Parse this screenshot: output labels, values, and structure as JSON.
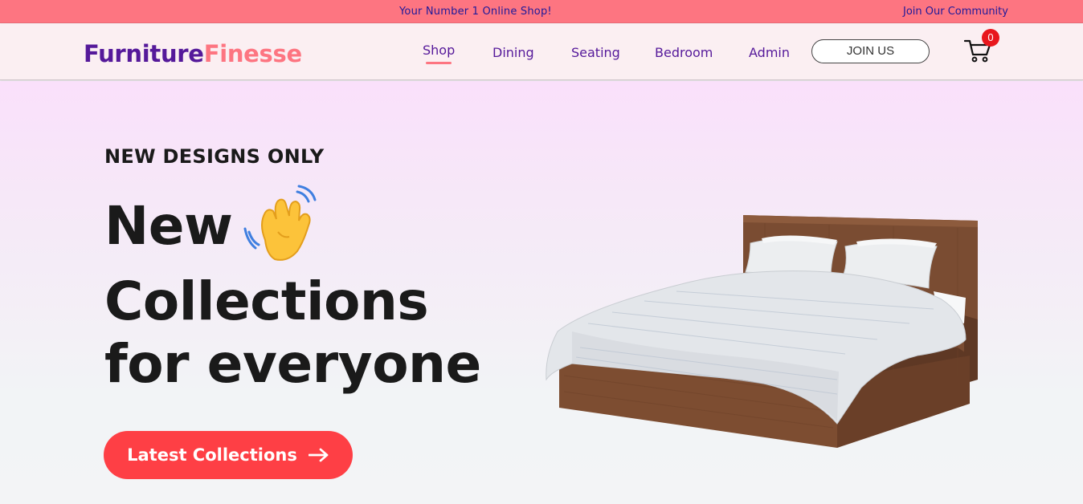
{
  "topbar": {
    "promo": "Your Number 1 Online Shop!",
    "community_link": "Join Our Community"
  },
  "header": {
    "logo_part1": "Furniture",
    "logo_part2": "Finesse",
    "nav": {
      "shop": "Shop",
      "dining": "Dining",
      "seating": "Seating",
      "bedroom": "Bedroom",
      "admin": "Admin"
    },
    "join_button": "JOIN US",
    "cart_count": "0"
  },
  "hero": {
    "kicker": "NEW DESIGNS ONLY",
    "line1": "New",
    "line2": "Collections",
    "line3": "for everyone",
    "cta_label": "Latest Collections"
  },
  "colors": {
    "topbar": "#fd7581",
    "brand_purple": "#55199a",
    "brand_pink": "#fd7581",
    "cta": "#fe3f45",
    "badge": "#e8171d"
  },
  "icons": [
    "cart-icon",
    "waving-hand-icon",
    "arrow-right-icon"
  ]
}
